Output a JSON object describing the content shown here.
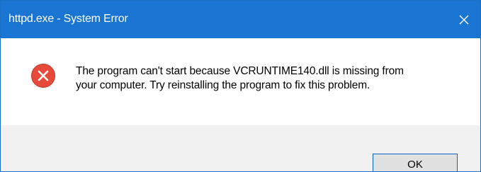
{
  "window": {
    "title": "httpd.exe - System Error",
    "close_icon": "close-icon",
    "titlebar_color": "#1a74d2"
  },
  "message": {
    "icon": "error-icon",
    "icon_color": "#e74c3c",
    "line1": "The program can't start because VCRUNTIME140.dll is missing from",
    "line2": "your computer. Try reinstalling the program to fix this problem."
  },
  "buttons": {
    "ok_label": "OK"
  }
}
